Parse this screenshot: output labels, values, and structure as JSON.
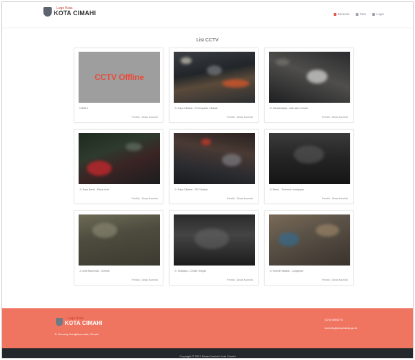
{
  "header": {
    "logo_small": "Logo Kota",
    "logo_big": "KOTA CIMAHI",
    "nav": [
      {
        "label": "Beranda",
        "icon": "home-icon"
      },
      {
        "label": "Peta",
        "icon": "map-icon"
      },
      {
        "label": "Login",
        "icon": "login-icon"
      }
    ]
  },
  "page": {
    "title": "List CCTV"
  },
  "cctv": [
    {
      "title": "CIMAHI",
      "owner": "Pemilik : Dinas Kominfo",
      "offline_text": "CCTV Offline"
    },
    {
      "title": "Jl. Raya Cibabat - Perempatan Cibabat",
      "owner": "Pemilik : Dinas Kominfo"
    },
    {
      "title": "Jl. Gandawijaya - Alun-alun Cimahi",
      "owner": "Pemilik : Dinas Kominfo"
    },
    {
      "title": "Jl. Raya Barat - Pasar Antri",
      "owner": "Pemilik : Dinas Kominfo"
    },
    {
      "title": "Jl. Raya Cibabat - RS Cibabat",
      "owner": "Pemilik : Dinas Kominfo"
    },
    {
      "title": "Jl. Baros - Terminal Leuwigajah",
      "owner": "Pemilik : Dinas Kominfo"
    },
    {
      "title": "Jl. Amir Machmud - Cimindi",
      "owner": "Pemilik : Dinas Kominfo"
    },
    {
      "title": "Jl. Sriwijaya - Cimahi Tengah",
      "owner": "Pemilik : Dinas Kominfo"
    },
    {
      "title": "Jl. Kolonel Masturi - Cipageran",
      "owner": "Pemilik : Dinas Kominfo"
    }
  ],
  "footer": {
    "logo_small": "Logo Kota",
    "logo_big": "KOTA CIMAHI",
    "address": "Jl. Demang Hardjakusumah, Cimahi",
    "phone": "(022) 6654274",
    "email": "kominfo@cimahikota.go.id",
    "copyright": "Copyright © 2021 Dinas Kominfo Kota Cimahi"
  },
  "colors": {
    "accent": "#f07561",
    "offline_text": "#e74c3c",
    "copy_bar": "#24272b"
  }
}
